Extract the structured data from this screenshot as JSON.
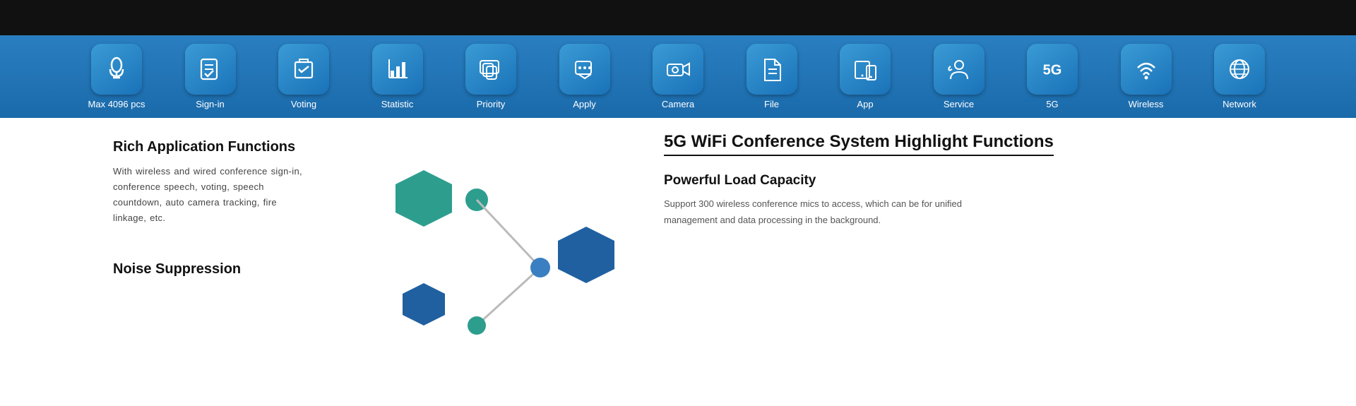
{
  "top_bar": {
    "bg": "#111"
  },
  "icon_bar": {
    "items": [
      {
        "id": "max4096",
        "label": "Max 4096 pcs",
        "icon": "mic"
      },
      {
        "id": "signin",
        "label": "Sign-in",
        "icon": "signin"
      },
      {
        "id": "voting",
        "label": "Voting",
        "icon": "voting"
      },
      {
        "id": "statistic",
        "label": "Statistic",
        "icon": "statistic"
      },
      {
        "id": "priority",
        "label": "Priority",
        "icon": "priority"
      },
      {
        "id": "apply",
        "label": "Apply",
        "icon": "apply"
      },
      {
        "id": "camera",
        "label": "Camera",
        "icon": "camera"
      },
      {
        "id": "file",
        "label": "File",
        "icon": "file"
      },
      {
        "id": "app",
        "label": "App",
        "icon": "app"
      },
      {
        "id": "service",
        "label": "Service",
        "icon": "service"
      },
      {
        "id": "fiveg",
        "label": "5G",
        "icon": "fiveg"
      },
      {
        "id": "wireless",
        "label": "Wireless",
        "icon": "wireless"
      },
      {
        "id": "network",
        "label": "Network",
        "icon": "network"
      }
    ]
  },
  "left": {
    "title1": "Rich Application Functions",
    "text1": "With wireless and wired conference sign-in, conference speech, voting, speech countdown, auto camera tracking, fire linkage, etc.",
    "title2": "Noise Suppression"
  },
  "right": {
    "main_title": "5G WiFi Conference System  Highlight Functions",
    "sub_title": "Powerful Load Capacity",
    "text": "Support 300 wireless conference mics to access, which can be  for unified management and data processing in the background."
  }
}
